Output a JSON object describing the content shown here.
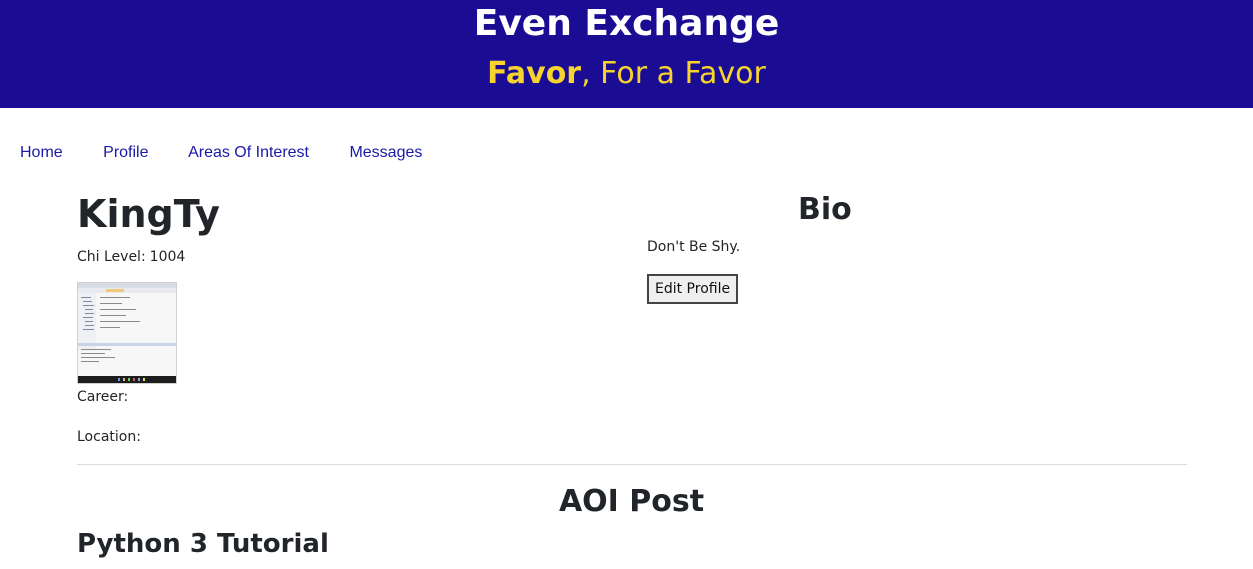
{
  "header": {
    "site_title": "Even Exchange",
    "tagline_strong": "Favor",
    "tagline_rest": ", For a Favor",
    "bg_color": "#1a0d94",
    "accent_color": "#f6d32d"
  },
  "nav": {
    "items": [
      {
        "label": "Home"
      },
      {
        "label": "Profile"
      },
      {
        "label": "Areas Of Interest"
      },
      {
        "label": "Messages"
      }
    ]
  },
  "profile": {
    "username": "KingTy",
    "chi_label": "Chi Level:",
    "chi_value": "1004",
    "career_label": "Career:",
    "location_label": "Location:",
    "avatar_icon": "screenshot-thumbnail"
  },
  "bio": {
    "title": "Bio",
    "text": "Don't Be Shy.",
    "edit_button": "Edit Profile"
  },
  "aoi": {
    "title": "AOI Post",
    "post_title": "Python 3 Tutorial"
  }
}
